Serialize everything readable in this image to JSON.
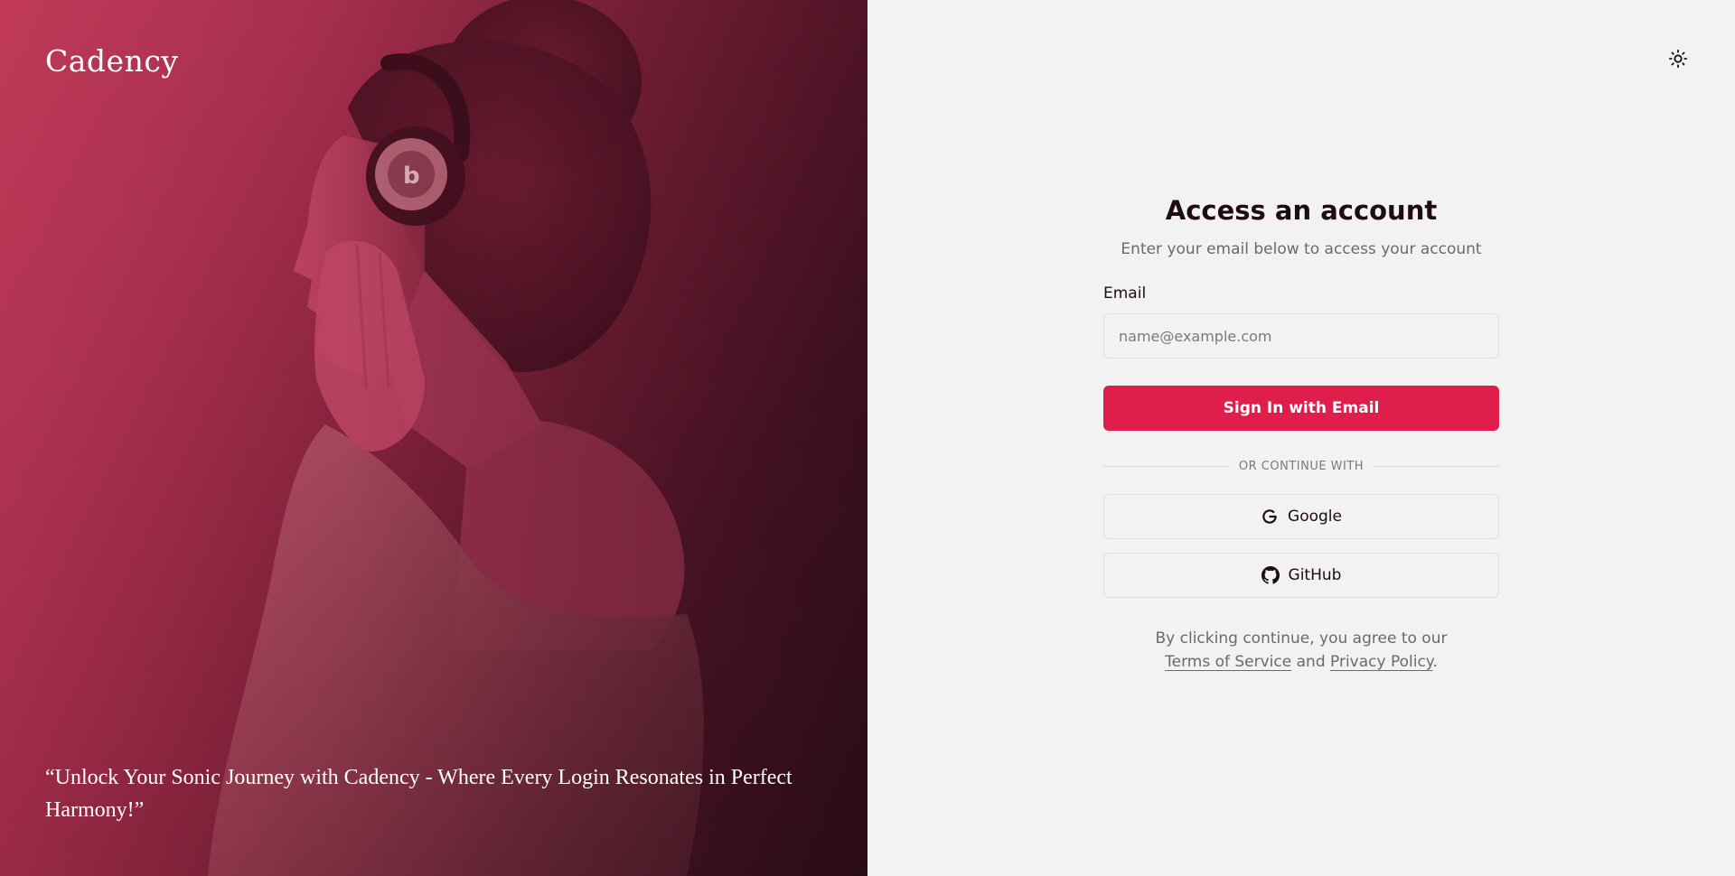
{
  "brand": {
    "name": "Cadency"
  },
  "hero": {
    "quote": "“Unlock Your Sonic Journey with Cadency - Where Every Login Resonates in Perfect Harmony!”",
    "image": "woman-with-headphones-photo"
  },
  "header": {
    "theme_toggle_icon": "sun-icon"
  },
  "login": {
    "title": "Access an account",
    "subtitle": "Enter your email below to access your account",
    "email_label": "Email",
    "email_placeholder": "name@example.com",
    "email_value": "",
    "submit_label": "Sign In with Email",
    "divider_text": "OR CONTINUE WITH",
    "google_label": "Google",
    "github_label": "GitHub",
    "terms_prefix": "By clicking continue, you agree to our",
    "terms_link": "Terms of Service",
    "terms_and": "and",
    "privacy_link": "Privacy Policy",
    "terms_suffix": "."
  },
  "colors": {
    "accent": "#e01e4b",
    "panel_background": "#f2f2f2",
    "hero_tint": "#b3344f",
    "text_primary": "#1f0b12",
    "text_muted": "#6f6670"
  }
}
